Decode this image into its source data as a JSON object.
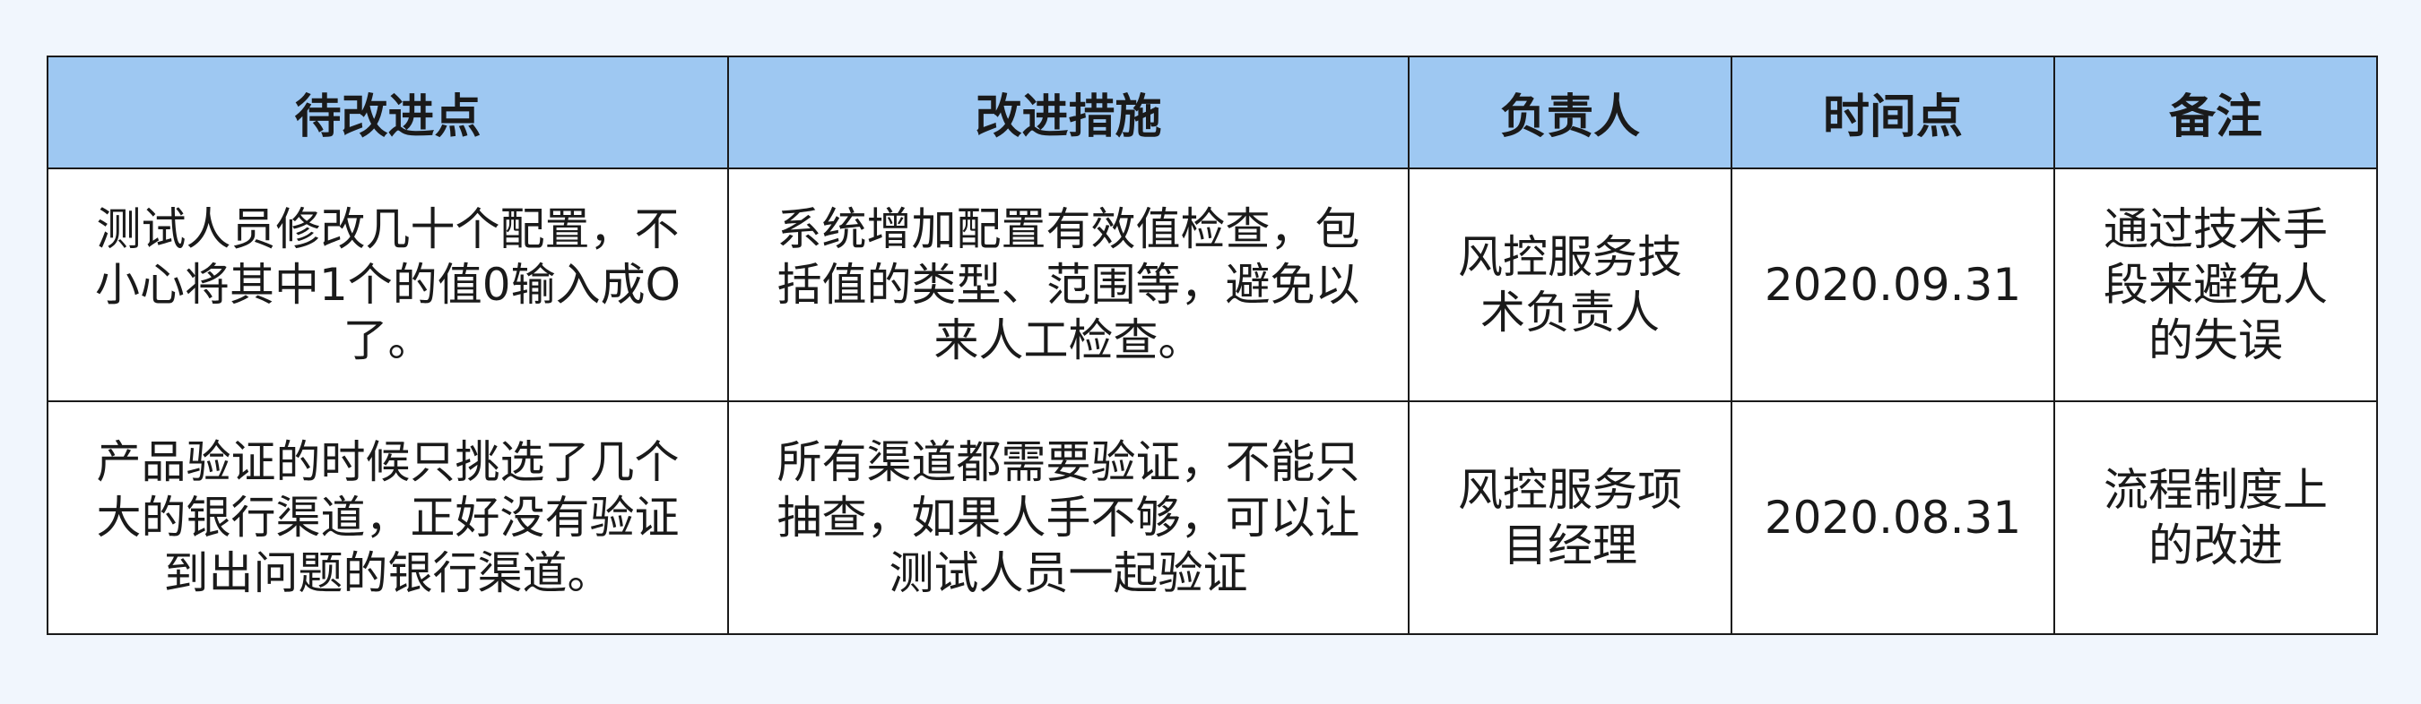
{
  "table": {
    "headers": [
      "待改进点",
      "改进措施",
      "负责人",
      "时间点",
      "备注"
    ],
    "rows": [
      {
        "issue": "测试人员修改几十个配置，不小心将其中1个的值0输入成O了。",
        "measure": "系统增加配置有效值检查，包括值的类型、范围等，避免以来人工检查。",
        "owner": "风控服务技术负责人",
        "date": "2020.09.31",
        "note": "通过技术手段来避免人的失误"
      },
      {
        "issue": "产品验证的时候只挑选了几个大的银行渠道，正好没有验证到出问题的银行渠道。",
        "measure": "所有渠道都需要验证，不能只抽查，如果人手不够，可以让测试人员一起验证",
        "owner": "风控服务项目经理",
        "date": "2020.08.31",
        "note": "流程制度上的改进"
      }
    ]
  }
}
